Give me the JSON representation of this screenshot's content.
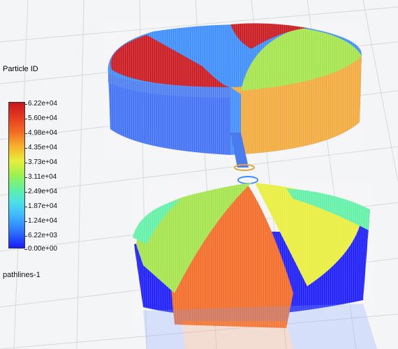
{
  "legend": {
    "title": "Particle ID",
    "ticks": [
      "6.22e+04",
      "5.60e+04",
      "4.98e+04",
      "4.35e+04",
      "3.73e+04",
      "3.11e+04",
      "2.49e+04",
      "1.87e+04",
      "1.24e+04",
      "6.22e+03",
      "0.00e+00"
    ],
    "colors": [
      "#1a1aff",
      "#3fb6ff",
      "#5ff0a5",
      "#e8ee3a",
      "#f26a23",
      "#c8161d"
    ]
  },
  "caption": "pathlines-1",
  "scene": {
    "background": "#f4f5f7",
    "grid_color": "#d8dadd",
    "upper_sectors": [
      "#c8161d",
      "#3a8cff",
      "#a3e34a",
      "#f2a93a",
      "#4a7cf0"
    ],
    "lower_sectors": [
      "#1a1aff",
      "#f26a23",
      "#e8ee3a",
      "#5ff0a5"
    ]
  }
}
